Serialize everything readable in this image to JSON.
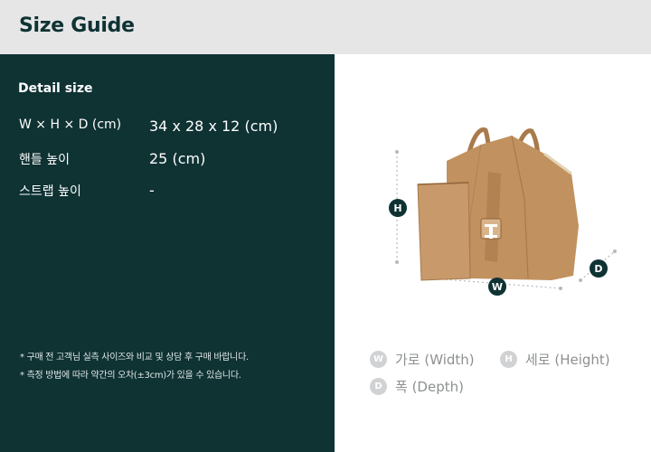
{
  "header": {
    "title": "Size Guide"
  },
  "detail": {
    "title": "Detail size",
    "rows": [
      {
        "label": "W × H × D (cm)",
        "value": "34 x 28 x 12 (cm)"
      },
      {
        "label": "핸들 높이",
        "value": "25 (cm)"
      },
      {
        "label": "스트랩 높이",
        "value": "-"
      }
    ],
    "notes": [
      "* 구매 전 고객님 실측 사이즈와 비교 및 상담 후 구매 바랍니다.",
      "* 측정 방법에 따라 약간의 오차(±3cm)가 있을 수 있습니다."
    ]
  },
  "figure": {
    "markers": {
      "h": "H",
      "w": "W",
      "d": "D"
    }
  },
  "legend": {
    "width": {
      "letter": "W",
      "label": "가로 (Width)"
    },
    "height": {
      "letter": "H",
      "label": "세로 (Height)"
    },
    "depth": {
      "letter": "D",
      "label": "폭 (Depth)"
    }
  },
  "colors": {
    "panel": "#0f3233",
    "header_bg": "#e6e6e6",
    "bag": "#c1915f",
    "marker": "#0f3233",
    "legend_dot": "#d0d2d3"
  }
}
